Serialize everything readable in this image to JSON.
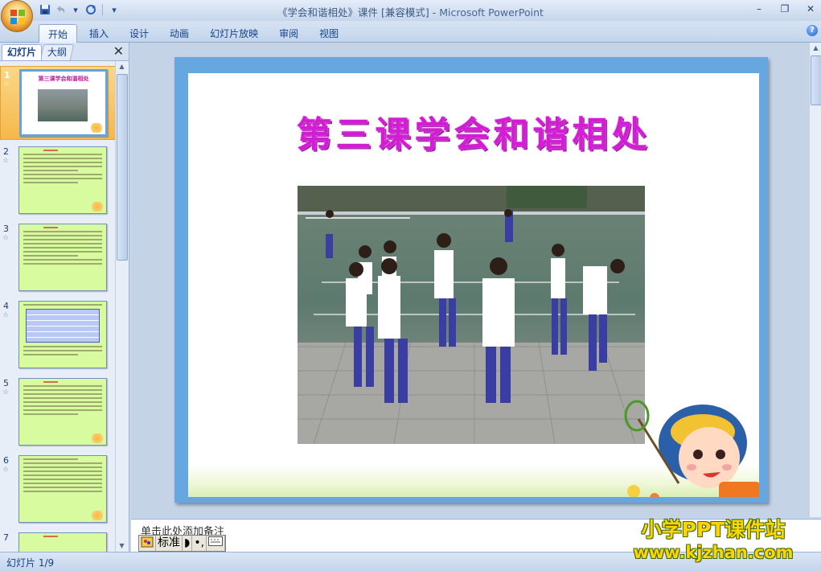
{
  "titlebar": {
    "title": "《学会和谐相处》课件 [兼容模式]",
    "separator": " - ",
    "app_name": "Microsoft PowerPoint",
    "qat": [
      "save-icon",
      "undo-icon",
      "redo-icon",
      "customize-qat-icon"
    ]
  },
  "ribbon": {
    "tabs": [
      "开始",
      "插入",
      "设计",
      "动画",
      "幻灯片放映",
      "审阅",
      "视图"
    ],
    "active_tab": "开始"
  },
  "panel": {
    "tab_slides": "幻灯片",
    "tab_outline": "大纲",
    "selected_slide": 1,
    "slides": [
      {
        "number": "1",
        "anim": "☆"
      },
      {
        "number": "2",
        "anim": "☆"
      },
      {
        "number": "3",
        "anim": "☆"
      },
      {
        "number": "4",
        "anim": "☆"
      },
      {
        "number": "5",
        "anim": "☆"
      },
      {
        "number": "6",
        "anim": "☆"
      },
      {
        "number": "7",
        "anim": ""
      }
    ],
    "thumb1_title": "第三课学会和谐相处"
  },
  "slide": {
    "title": "第三课学会和谐相处",
    "border_color": "#66a7e0",
    "title_color": "#d21ed2"
  },
  "notes": {
    "placeholder": "单击此处添加备注"
  },
  "ime": {
    "mode": "标准",
    "icons": [
      "ime-logo-icon",
      "moon-icon",
      "punctuation-icon",
      "keyboard-icon"
    ]
  },
  "watermark": {
    "line1": "小学PPT课件站",
    "line2": "www.kjzhan.com"
  },
  "status": {
    "slide_counter": "幻灯片 1/9"
  }
}
